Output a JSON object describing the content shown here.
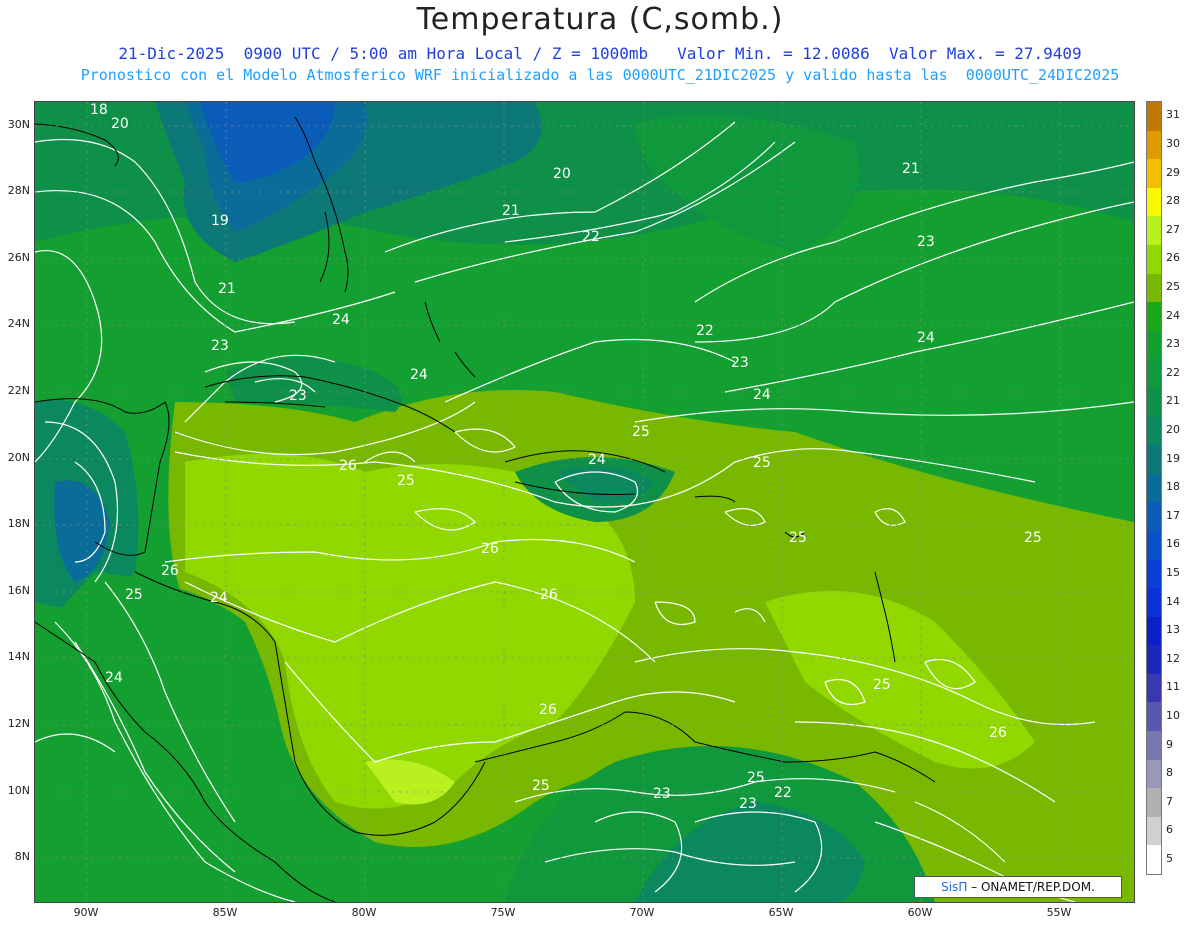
{
  "header": {
    "title": "Temperatura (C,somb.)",
    "line1": "21-Dic-2025  0900 UTC / 5:00 am Hora Local / Z = 1000mb   Valor Min. = 12.0086  Valor Max. = 27.9409",
    "line2": "Pronostico con el Modelo Atmosferico WRF inicializado a las 0000UTC_21DIC2025 y valido hasta las  0000UTC_24DIC2025"
  },
  "axes": {
    "lat_labels": [
      "30N",
      "28N",
      "26N",
      "24N",
      "22N",
      "20N",
      "18N",
      "16N",
      "14N",
      "12N",
      "10N",
      "8N"
    ],
    "lon_labels": [
      "90W",
      "85W",
      "80W",
      "75W",
      "70W",
      "65W",
      "60W",
      "55W"
    ]
  },
  "colorbar": {
    "labels": [
      "31",
      "30",
      "29",
      "28",
      "27",
      "26",
      "25",
      "24",
      "23",
      "22",
      "21",
      "20",
      "19",
      "18",
      "17",
      "16",
      "15",
      "14",
      "13",
      "12",
      "11",
      "10",
      "9",
      "8",
      "7",
      "6",
      "5"
    ],
    "colors": [
      "#c07800",
      "#e09a00",
      "#f0c000",
      "#f8f800",
      "#b8f020",
      "#90d800",
      "#78b800",
      "#18a818",
      "#14a030",
      "#10983c",
      "#0e9048",
      "#0c8860",
      "#0c7878",
      "#0a6c98",
      "#0a5cb8",
      "#0a50c8",
      "#0a40d8",
      "#0a30d8",
      "#0a20c8",
      "#1c28b8",
      "#3838b0",
      "#5858b0",
      "#7878b0",
      "#9898b8",
      "#b0b0b0",
      "#d0d0d0",
      "#ffffff"
    ]
  },
  "contour_labels": [
    "18",
    "20",
    "19",
    "21",
    "23",
    "24",
    "20",
    "21",
    "22",
    "21",
    "23",
    "22",
    "24",
    "23",
    "24",
    "24",
    "23",
    "25",
    "26",
    "25",
    "24",
    "25",
    "26",
    "26",
    "26",
    "24",
    "25",
    "24",
    "26",
    "25",
    "26",
    "25",
    "23",
    "23",
    "22",
    "25",
    "25",
    "25",
    "24"
  ],
  "credit": {
    "brand": "SisΠ",
    "text": "– ONAMET/REP.DOM."
  }
}
